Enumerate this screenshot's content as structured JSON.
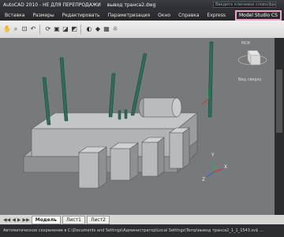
{
  "app": {
    "title": "AutoCAD 2010 - НЕ ДЛЯ ПЕРЕПРОДАЖИ",
    "document": "вывод транса2.dwg",
    "search_placeholder": "Введите ключевое слово/фразу"
  },
  "menu": {
    "items": [
      "Вставка",
      "Размеры",
      "Редактировать",
      "Параметризация",
      "Окно",
      "Справка",
      "Express"
    ],
    "plugin": "Model Studio CS"
  },
  "toolbar": {
    "icons": [
      "pan-icon",
      "zoom-realtime-icon",
      "zoom-window-icon",
      "zoom-previous-icon",
      "orbit-icon",
      "camera-icon",
      "walk-icon",
      "fly-icon",
      "visual-style-icon",
      "render-icon",
      "materials-icon",
      "lights-icon"
    ]
  },
  "viewcube": {
    "wcs_label": "МСК",
    "view_label": "Вид сверху"
  },
  "ucs": {
    "x_label": "X",
    "y_label": "Y",
    "z_label": "Z"
  },
  "tabs": {
    "items": [
      "Модель",
      "Лист1",
      "Лист2"
    ],
    "active": "Модель"
  },
  "status": {
    "text": "Автоматическое сохранение в C:\\Documents and Settings\\Администратор\\Local Settings\\Temp\\вывод транса2_1_1_1543.sv$ ..."
  },
  "colors": {
    "accent": "#e8a6c8",
    "viewport_bg": "#767a7d",
    "transformer_body": "#b7b9bc",
    "insulators": "#2f6b5a"
  }
}
